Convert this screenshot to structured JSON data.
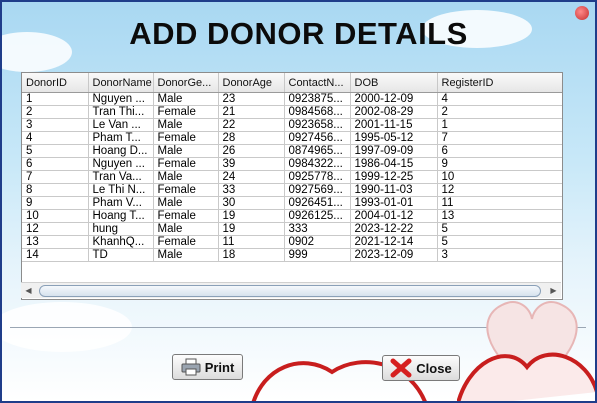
{
  "title": "ADD DONOR DETAILS",
  "table": {
    "columns": [
      "DonorID",
      "DonorName",
      "DonorGe...",
      "DonorAge",
      "ContactN...",
      "DOB",
      "RegisterID"
    ],
    "rows": [
      [
        "1",
        "Nguyen ...",
        "Male",
        "23",
        "0923875...",
        "2000-12-09",
        "4"
      ],
      [
        "2",
        "Tran Thi...",
        "Female",
        "21",
        "0984568...",
        "2002-08-29",
        "2"
      ],
      [
        "3",
        "Le Van ...",
        "Male",
        "22",
        "0923658...",
        "2001-11-15",
        "1"
      ],
      [
        "4",
        "Pham T...",
        "Female",
        "28",
        "0927456...",
        "1995-05-12",
        "7"
      ],
      [
        "5",
        "Hoang D...",
        "Male",
        "26",
        "0874965...",
        "1997-09-09",
        "6"
      ],
      [
        "6",
        "Nguyen ...",
        "Female",
        "39",
        "0984322...",
        "1986-04-15",
        "9"
      ],
      [
        "7",
        "Tran Va...",
        "Male",
        "24",
        "0925778...",
        "1999-12-25",
        "10"
      ],
      [
        "8",
        "Le Thi N...",
        "Female",
        "33",
        "0927569...",
        "1990-11-03",
        "12"
      ],
      [
        "9",
        "Pham V...",
        "Male",
        "30",
        "0926451...",
        "1993-01-01",
        "11"
      ],
      [
        "10",
        "Hoang T...",
        "Female",
        "19",
        "0926125...",
        "2004-01-12",
        "13"
      ],
      [
        "12",
        "hung",
        "Male",
        "19",
        "333",
        "2023-12-22",
        "5"
      ],
      [
        "13",
        "KhanhQ...",
        "Female",
        "11",
        "0902",
        "2021-12-14",
        "5"
      ],
      [
        "14",
        "TD",
        "Male",
        "18",
        "999",
        "2023-12-09",
        "3"
      ]
    ]
  },
  "buttons": {
    "print_label": "Print",
    "close_label": "Close"
  },
  "icons": {
    "print": "printer-icon",
    "close": "red-x-icon"
  },
  "colors": {
    "frame_border": "#1f3d8a",
    "close_icon": "#d62020",
    "heart_outline": "#c81e1e"
  }
}
